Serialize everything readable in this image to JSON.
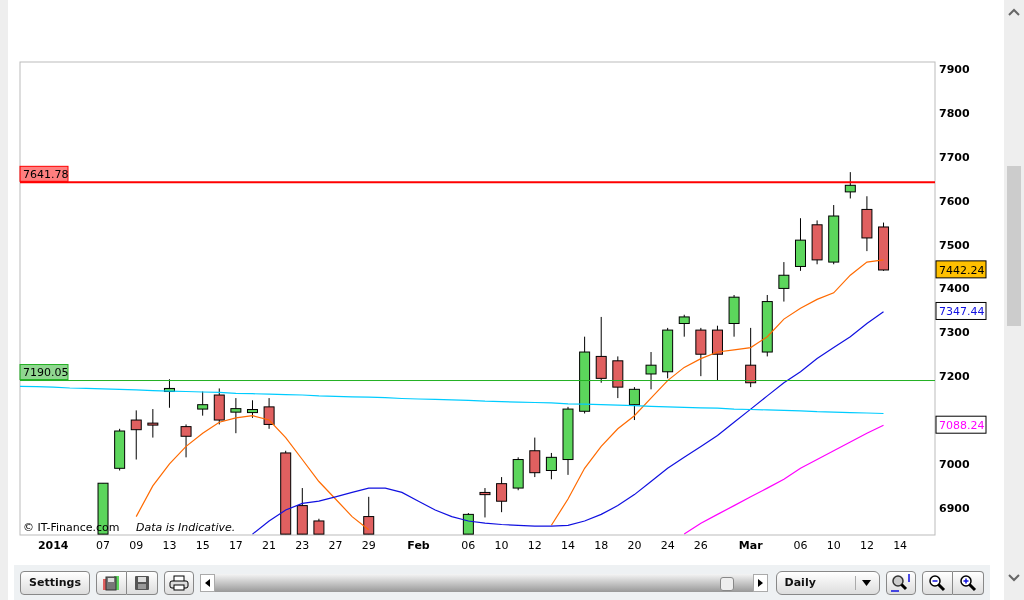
{
  "chart": {
    "credit": "© IT-Finance.com",
    "disclaimer": "Data is Indicative.",
    "price_tags": [
      {
        "label": "7442.24",
        "color": "#ffc000",
        "kind": "filled"
      },
      {
        "label": "7347.44",
        "color": "#1010e0",
        "kind": "outlined"
      },
      {
        "label": "7088.24",
        "color": "#ff00ff",
        "kind": "outlined"
      }
    ],
    "chart_data": {
      "type": "candlestick",
      "ylim": [
        6838,
        7916
      ],
      "yticks": [
        6900,
        7000,
        7200,
        7300,
        7400,
        7500,
        7600,
        7700,
        7800,
        7900
      ],
      "categories": [
        null,
        null,
        "2014",
        null,
        null,
        "07",
        null,
        "09",
        null,
        "13",
        null,
        "15",
        null,
        "17",
        null,
        "21",
        null,
        "23",
        null,
        "27",
        null,
        "29",
        null,
        null,
        "Feb",
        null,
        null,
        "06",
        null,
        "10",
        null,
        "12",
        null,
        "14",
        null,
        "18",
        null,
        "20",
        null,
        "24",
        null,
        "26",
        null,
        null,
        "Mar",
        null,
        null,
        "06",
        null,
        "10",
        null,
        "12",
        null,
        "14"
      ],
      "ohlc": [
        null,
        null,
        null,
        null,
        null,
        [
          6840,
          6956,
          6840,
          6956
        ],
        [
          6990,
          7080,
          6985,
          7075
        ],
        [
          7100,
          7122,
          7010,
          7078
        ],
        [
          7093,
          7125,
          7060,
          7090
        ],
        [
          7165,
          7193,
          7128,
          7172
        ],
        [
          7085,
          7090,
          7015,
          7063
        ],
        [
          7125,
          7165,
          7110,
          7135
        ],
        [
          7157,
          7172,
          7090,
          7100
        ],
        [
          7118,
          7150,
          7070,
          7126
        ],
        [
          7117,
          7145,
          7105,
          7124
        ],
        [
          7130,
          7150,
          7080,
          7090
        ],
        [
          7025,
          7030,
          6840,
          6840
        ],
        [
          6905,
          6945,
          6840,
          6840
        ],
        [
          6870,
          6875,
          6840,
          6840
        ],
        null,
        null,
        [
          6880,
          6925,
          6840,
          6840
        ],
        null,
        null,
        null,
        null,
        null,
        [
          6840,
          6888,
          6840,
          6885
        ],
        [
          6935,
          6945,
          6878,
          6930
        ],
        [
          6955,
          6970,
          6890,
          6915
        ],
        [
          6945,
          7015,
          6940,
          7010
        ],
        [
          7030,
          7060,
          6970,
          6980
        ],
        [
          6985,
          7025,
          6965,
          7015
        ],
        [
          7010,
          7130,
          6975,
          7125
        ],
        [
          7120,
          7290,
          7115,
          7255
        ],
        [
          7245,
          7335,
          7185,
          7195
        ],
        [
          7235,
          7245,
          7150,
          7175
        ],
        [
          7135,
          7175,
          7100,
          7170
        ],
        [
          7205,
          7255,
          7170,
          7225
        ],
        [
          7210,
          7310,
          7195,
          7305
        ],
        [
          7320,
          7340,
          7290,
          7335
        ],
        [
          7305,
          7310,
          7200,
          7250
        ],
        [
          7305,
          7315,
          7190,
          7250
        ],
        [
          7320,
          7385,
          7290,
          7380
        ],
        [
          7225,
          7310,
          7175,
          7185
        ],
        [
          7255,
          7385,
          7245,
          7370
        ],
        [
          7400,
          7460,
          7370,
          7430
        ],
        [
          7450,
          7560,
          7440,
          7510
        ],
        [
          7545,
          7555,
          7455,
          7465
        ],
        [
          7460,
          7590,
          7455,
          7565
        ],
        [
          7620,
          7665,
          7605,
          7635
        ],
        [
          7580,
          7610,
          7485,
          7515
        ],
        [
          7540,
          7550,
          7440,
          7442
        ],
        null
      ],
      "series": [
        {
          "type": "line",
          "color": "#ff6a00",
          "values": [
            null,
            null,
            null,
            null,
            null,
            null,
            null,
            6880,
            6950,
            7000,
            7040,
            7070,
            7095,
            7105,
            7110,
            7100,
            7060,
            7010,
            6960,
            6920,
            6880,
            6850,
            null,
            null,
            null,
            null,
            null,
            null,
            null,
            null,
            null,
            null,
            6860,
            6920,
            6990,
            7040,
            7080,
            7110,
            7150,
            7190,
            7220,
            7240,
            7255,
            7260,
            7265,
            7290,
            7330,
            7355,
            7375,
            7390,
            7430,
            7460,
            7465,
            null
          ]
        },
        {
          "type": "line",
          "color": "#1010e0",
          "values": [
            null,
            null,
            null,
            null,
            null,
            null,
            null,
            null,
            null,
            null,
            null,
            null,
            null,
            null,
            6840,
            6870,
            6895,
            6910,
            6915,
            6925,
            6935,
            6945,
            6945,
            6935,
            6915,
            6895,
            6880,
            6870,
            6865,
            6862,
            6860,
            6858,
            6858,
            6860,
            6870,
            6885,
            6905,
            6930,
            6960,
            6990,
            7015,
            7040,
            7065,
            7095,
            7125,
            7155,
            7185,
            7210,
            7240,
            7265,
            7290,
            7320,
            7347,
            null
          ]
        },
        {
          "type": "line",
          "color": "#ff00ff",
          "values": [
            null,
            null,
            null,
            null,
            null,
            null,
            null,
            null,
            null,
            null,
            null,
            null,
            null,
            null,
            null,
            null,
            null,
            null,
            null,
            null,
            null,
            null,
            null,
            null,
            null,
            null,
            null,
            null,
            null,
            null,
            null,
            null,
            null,
            null,
            null,
            null,
            null,
            null,
            null,
            null,
            6840,
            6865,
            6885,
            6905,
            6925,
            6945,
            6965,
            6990,
            7010,
            7030,
            7050,
            7070,
            7088,
            null
          ]
        },
        {
          "type": "line",
          "color": "#00ccff",
          "values": [
            7177,
            7176,
            7175,
            7173,
            7172,
            7171,
            7170,
            7169,
            7167,
            7166,
            7165,
            7164,
            7163,
            7161,
            7160,
            7159,
            7158,
            7157,
            7155,
            7154,
            7153,
            7152,
            7151,
            7149,
            7148,
            7147,
            7146,
            7145,
            7143,
            7142,
            7141,
            7140,
            7139,
            7137,
            7136,
            7135,
            7134,
            7133,
            7131,
            7130,
            7129,
            7128,
            7127,
            7125,
            7124,
            7123,
            7122,
            7121,
            7119,
            7118,
            7117,
            7116,
            7115,
            null
          ]
        }
      ],
      "ref_lines": [
        {
          "axis": "y",
          "value": 7641.78,
          "label": "7641.78",
          "color": "#ff0000"
        },
        {
          "axis": "y",
          "value": 7190.05,
          "label": "7190.05",
          "color": "#22b022"
        }
      ]
    }
  },
  "toolbar": {
    "settings_button": "Settings",
    "interval_select": {
      "value": "Daily"
    }
  }
}
